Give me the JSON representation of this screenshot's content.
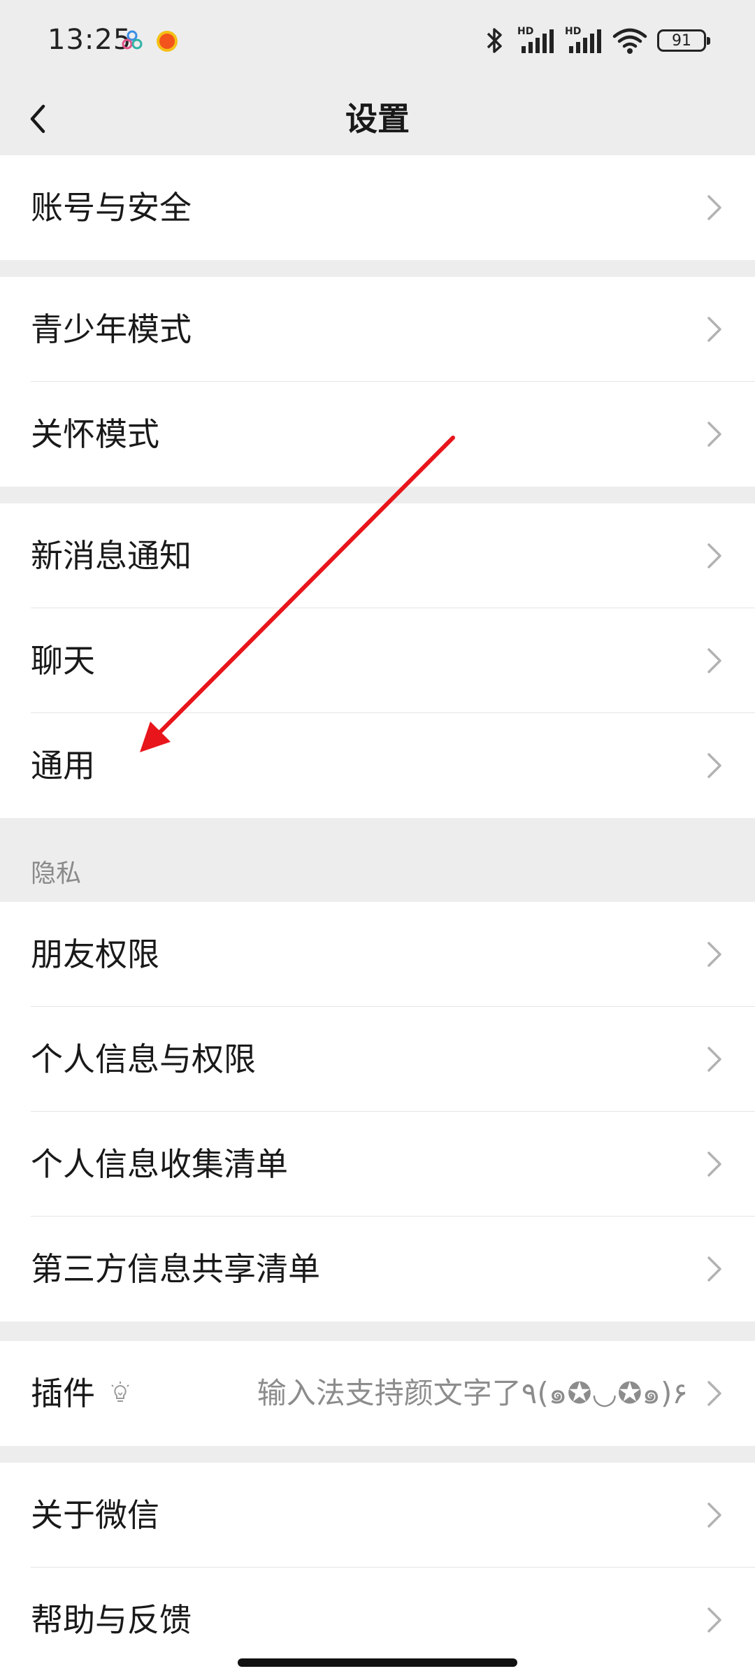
{
  "status_bar": {
    "time": "13:25",
    "battery": "91",
    "signal_label_1": "HD",
    "signal_label_2": "HD"
  },
  "nav": {
    "title": "设置"
  },
  "groups": {
    "account": {
      "account_security": "账号与安全"
    },
    "modes": {
      "teen_mode": "青少年模式",
      "care_mode": "关怀模式"
    },
    "general": {
      "notifications": "新消息通知",
      "chat": "聊天",
      "general": "通用"
    },
    "privacy": {
      "header": "隐私",
      "friend_permissions": "朋友权限",
      "personal_info_permissions": "个人信息与权限",
      "info_collection_list": "个人信息收集清单",
      "third_party_sharing_list": "第三方信息共享清单"
    },
    "plugins": {
      "label": "插件",
      "value": "输入法支持颜文字了٩(๑✪◡✪๑)۶"
    },
    "about": {
      "about_wechat": "关于微信",
      "help_feedback": "帮助与反馈"
    }
  },
  "colors": {
    "background": "#ededed",
    "card": "#ffffff",
    "annotation_arrow": "#e8151b",
    "secondary_text": "#8c8c8c"
  }
}
